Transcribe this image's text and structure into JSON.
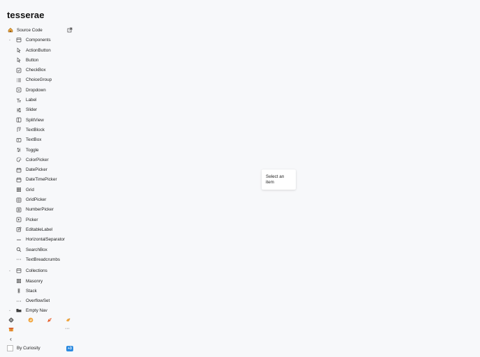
{
  "app": {
    "title": "tesserae"
  },
  "sidebar": {
    "source_code": {
      "label": "Source Code",
      "icon": "house-icon"
    },
    "components_group": {
      "label": "Components",
      "icon": "box-icon"
    },
    "components": [
      {
        "label": "ActionButton",
        "icon": "cursor-icon"
      },
      {
        "label": "Button",
        "icon": "cursor-icon"
      },
      {
        "label": "CheckBox",
        "icon": "checkbox-icon"
      },
      {
        "label": "ChoiceGroup",
        "icon": "list-icon"
      },
      {
        "label": "Dropdown",
        "icon": "dropdown-icon"
      },
      {
        "label": "Label",
        "icon": "text-icon"
      },
      {
        "label": "Slider",
        "icon": "sliders-icon"
      },
      {
        "label": "SplitView",
        "icon": "split-icon"
      },
      {
        "label": "TextBlock",
        "icon": "paragraph-icon"
      },
      {
        "label": "TextBox",
        "icon": "textbox-icon"
      },
      {
        "label": "Toggle",
        "icon": "toggle-icon"
      },
      {
        "label": "ColorPicker",
        "icon": "palette-icon"
      },
      {
        "label": "DatePicker",
        "icon": "calendar-icon"
      },
      {
        "label": "DateTimePicker",
        "icon": "calendar-icon"
      },
      {
        "label": "Grid",
        "icon": "grid-icon"
      },
      {
        "label": "GridPicker",
        "icon": "gridpicker-icon"
      },
      {
        "label": "NumberPicker",
        "icon": "number-icon"
      },
      {
        "label": "Picker",
        "icon": "picker-icon"
      },
      {
        "label": "EditableLabel",
        "icon": "edit-icon"
      },
      {
        "label": "HorizontalSeparator",
        "icon": "separator-icon"
      },
      {
        "label": "SearchBox",
        "icon": "search-icon"
      },
      {
        "label": "TextBreadcrumbs",
        "icon": "dots-icon"
      }
    ],
    "collections_group": {
      "label": "Collections",
      "icon": "box-icon"
    },
    "collections": [
      {
        "label": "Masonry",
        "icon": "grid-icon"
      },
      {
        "label": "Stack",
        "icon": "stack-icon"
      },
      {
        "label": "OverflowSet",
        "icon": "dots-icon"
      }
    ],
    "empty_nav": {
      "label": "Empty Nav",
      "icon": "folder-icon"
    },
    "quick_actions": [
      "gear-icon",
      "sticker-icon",
      "rocket-icon",
      "bird-icon",
      "gift-icon",
      "more-icon"
    ],
    "collapse": {
      "icon": "chevron-left-icon"
    },
    "footer": {
      "label": "By Curiosity",
      "badge": "+3"
    }
  },
  "main": {
    "placeholder": {
      "line1": "Select an",
      "line2": "item"
    }
  }
}
